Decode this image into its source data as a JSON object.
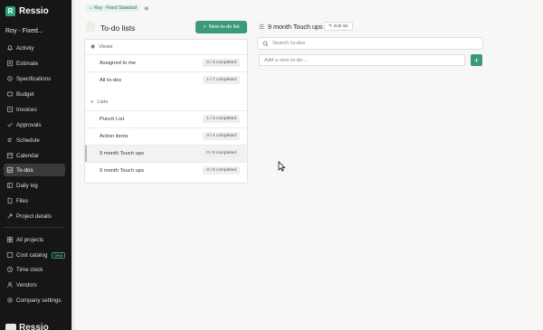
{
  "app": {
    "name": "Ressio"
  },
  "project_selector": "Roy - Fixed...",
  "sidebar": {
    "items": [
      {
        "label": "Activity",
        "icon": "bell-icon"
      },
      {
        "label": "Estimate",
        "icon": "estimate-icon"
      },
      {
        "label": "Specifications",
        "icon": "specifications-icon"
      },
      {
        "label": "Budget",
        "icon": "budget-icon"
      },
      {
        "label": "Invoices",
        "icon": "invoices-icon"
      },
      {
        "label": "Approvals",
        "icon": "approvals-icon"
      },
      {
        "label": "Schedule",
        "icon": "schedule-icon"
      },
      {
        "label": "Calendar",
        "icon": "calendar-icon"
      },
      {
        "label": "To-dos",
        "icon": "todos-icon",
        "active": true
      },
      {
        "label": "Daily log",
        "icon": "daily-log-icon"
      },
      {
        "label": "Files",
        "icon": "files-icon"
      },
      {
        "label": "Project details",
        "icon": "project-details-icon"
      }
    ],
    "global_items": [
      {
        "label": "All projects",
        "icon": "grid-icon"
      },
      {
        "label": "Cost catalog",
        "icon": "catalog-icon",
        "badge": "beta"
      },
      {
        "label": "Time clock",
        "icon": "clock-icon"
      },
      {
        "label": "Vendors",
        "icon": "vendors-icon"
      },
      {
        "label": "Company settings",
        "icon": "gear-icon"
      }
    ]
  },
  "breadcrumb": {
    "label": "Roy - Fixed Standard"
  },
  "todo_panel": {
    "title": "To-do lists",
    "new_button": "New to-do list",
    "views_header": "Views",
    "views": [
      {
        "label": "Assigned to me",
        "count": "0 / 3 completed"
      },
      {
        "label": "All to-dos",
        "count": "1 / 7 completed"
      }
    ],
    "lists_header": "Lists",
    "lists": [
      {
        "label": "Punch List",
        "count": "1 / 3 completed"
      },
      {
        "label": "Action items",
        "count": "0 / 4 completed"
      },
      {
        "label": "9 month Touch ups",
        "count": "0 / 0 completed",
        "selected": true
      },
      {
        "label": "9 month Touch ups",
        "count": "0 / 0 completed"
      }
    ]
  },
  "detail": {
    "title": "9 month Touch ups",
    "edit_button": "Edit list",
    "search_placeholder": "Search to-dos",
    "add_placeholder": "Add a new to-do...",
    "add_button": "+"
  },
  "colors": {
    "brand": "#3c9a78",
    "sidebar_bg": "#161616"
  }
}
